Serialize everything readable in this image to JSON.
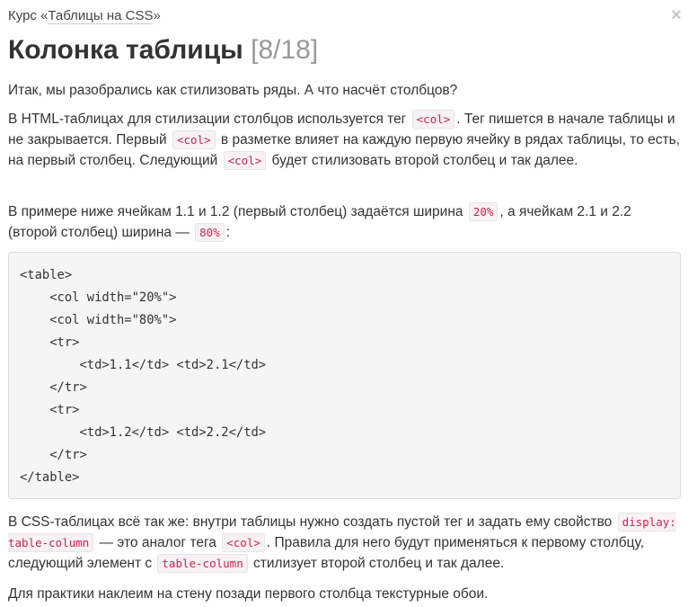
{
  "header": {
    "course_prefix": "Курс «",
    "course_name": "Таблицы на CSS",
    "course_suffix": "»",
    "close_glyph": "×",
    "title": "Колонка таблицы",
    "progress": "[8/18]"
  },
  "content": {
    "p1": "Итак, мы разобрались как стилизовать ряды. А что насчёт столбцов?",
    "p2": {
      "t1": "В HTML-таблицах для стилизации столбцов используется тег",
      "c1": "<col>",
      "t2": ". Тег пишется в начале таблицы и не закрывается. Первый",
      "c2": "<col>",
      "t3": "в разметке влияет на каждую первую ячейку в рядах таблицы, то есть, на первый столбец. Следующий",
      "c3": "<col>",
      "t4": "будет стилизовать второй столбец и так далее."
    },
    "p3": {
      "t1": "В примере ниже ячейкам 1.1 и 1.2 (первый столбец) задаётся ширина",
      "c1": "20%",
      "t2": ", а ячейкам 2.1 и 2.2 (второй столбец) ширина —",
      "c2": "80%",
      "t3": ":"
    },
    "code_lines": [
      "<table>",
      "    <col width=\"20%\">",
      "    <col width=\"80%\">",
      "    <tr>",
      "        <td>1.1</td> <td>2.1</td>",
      "    </tr>",
      "    <tr>",
      "        <td>1.2</td> <td>2.2</td>",
      "    </tr>",
      "</table>"
    ],
    "p4": {
      "t1": "В CSS-таблицах всё так же: внутри таблицы нужно создать пустой тег и задать ему свойство",
      "c1": "display: table-column",
      "t2": "— это аналог тега",
      "c2": "<col>",
      "t3": ". Правила для него будут применяться к первому столбцу, следующий элемент с",
      "c3": "table-column",
      "t4": "стилизует второй столбец и так далее."
    },
    "p5": "Для практики наклеим на стену позади первого столбца текстурные обои."
  }
}
